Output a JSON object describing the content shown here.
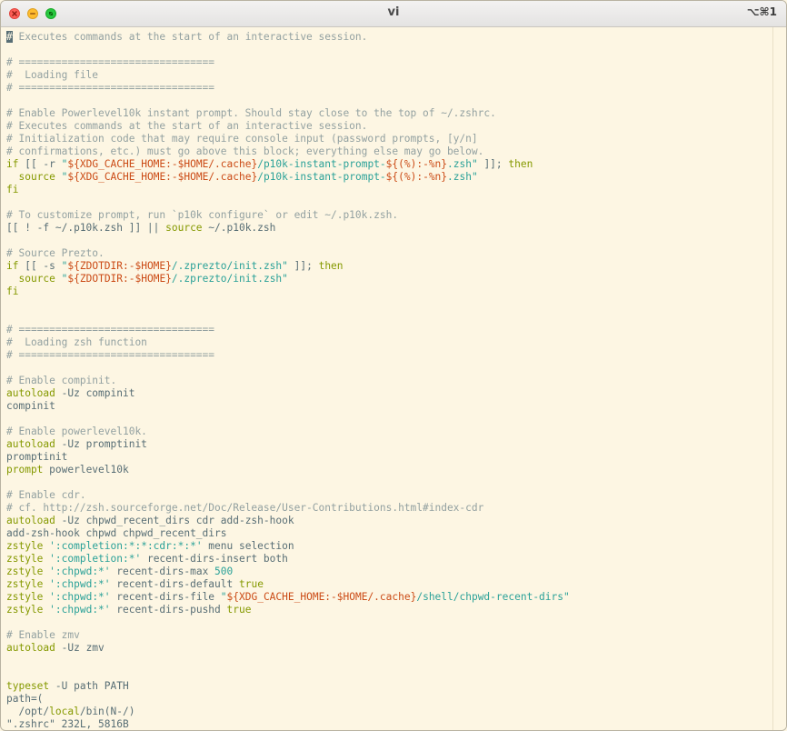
{
  "window": {
    "title": "vi",
    "shortcut": "⌥⌘1"
  },
  "colors": {
    "background": "#fdf6e3",
    "text": "#586e75",
    "comment": "#93a1a1",
    "keyword": "#859900",
    "string": "#2aa198",
    "variable": "#cb4b16",
    "number": "#2aa198"
  },
  "editor": {
    "lines": [
      [
        {
          "t": "#",
          "c": "cursor"
        },
        {
          "t": " Executes commands at the start of an interactive session.",
          "c": "comment"
        }
      ],
      [],
      [
        {
          "t": "# ================================",
          "c": "comment"
        }
      ],
      [
        {
          "t": "#  Loading file",
          "c": "comment"
        }
      ],
      [
        {
          "t": "# ================================",
          "c": "comment"
        }
      ],
      [],
      [
        {
          "t": "# Enable Powerlevel10k instant prompt. Should stay close to the top of ~/.zshrc.",
          "c": "comment"
        }
      ],
      [
        {
          "t": "# Executes commands at the start of an interactive session.",
          "c": "comment"
        }
      ],
      [
        {
          "t": "# Initialization code that may require console input (password prompts, [y/n]",
          "c": "comment"
        }
      ],
      [
        {
          "t": "# confirmations, etc.) must go above this block; everything else may go below.",
          "c": "comment"
        }
      ],
      [
        {
          "t": "if",
          "c": "keyword"
        },
        {
          "t": " [[ -r ",
          "c": "text"
        },
        {
          "t": "\"",
          "c": "string"
        },
        {
          "t": "${XDG_CACHE_HOME:-$HOME/.cache}",
          "c": "variable"
        },
        {
          "t": "/p10k-instant-prompt-",
          "c": "string"
        },
        {
          "t": "${(%):-%n}",
          "c": "variable"
        },
        {
          "t": ".zsh\"",
          "c": "string"
        },
        {
          "t": " ]]; ",
          "c": "text"
        },
        {
          "t": "then",
          "c": "keyword"
        }
      ],
      [
        {
          "t": "  ",
          "c": "text"
        },
        {
          "t": "source",
          "c": "keyword"
        },
        {
          "t": " ",
          "c": "text"
        },
        {
          "t": "\"",
          "c": "string"
        },
        {
          "t": "${XDG_CACHE_HOME:-$HOME/.cache}",
          "c": "variable"
        },
        {
          "t": "/p10k-instant-prompt-",
          "c": "string"
        },
        {
          "t": "${(%):-%n}",
          "c": "variable"
        },
        {
          "t": ".zsh\"",
          "c": "string"
        }
      ],
      [
        {
          "t": "fi",
          "c": "keyword"
        }
      ],
      [],
      [
        {
          "t": "# To customize prompt, run `p10k configure` or edit ~/.p10k.zsh.",
          "c": "comment"
        }
      ],
      [
        {
          "t": "[[ ! -f ~/.p10k.zsh ]] || ",
          "c": "text"
        },
        {
          "t": "source",
          "c": "keyword"
        },
        {
          "t": " ~/.p10k.zsh",
          "c": "text"
        }
      ],
      [],
      [
        {
          "t": "# Source Prezto.",
          "c": "comment"
        }
      ],
      [
        {
          "t": "if",
          "c": "keyword"
        },
        {
          "t": " [[ -s ",
          "c": "text"
        },
        {
          "t": "\"",
          "c": "string"
        },
        {
          "t": "${ZDOTDIR:-$HOME}",
          "c": "variable"
        },
        {
          "t": "/.zprezto/init.zsh\"",
          "c": "string"
        },
        {
          "t": " ]]; ",
          "c": "text"
        },
        {
          "t": "then",
          "c": "keyword"
        }
      ],
      [
        {
          "t": "  ",
          "c": "text"
        },
        {
          "t": "source",
          "c": "keyword"
        },
        {
          "t": " ",
          "c": "text"
        },
        {
          "t": "\"",
          "c": "string"
        },
        {
          "t": "${ZDOTDIR:-$HOME}",
          "c": "variable"
        },
        {
          "t": "/.zprezto/init.zsh\"",
          "c": "string"
        }
      ],
      [
        {
          "t": "fi",
          "c": "keyword"
        }
      ],
      [],
      [],
      [
        {
          "t": "# ================================",
          "c": "comment"
        }
      ],
      [
        {
          "t": "#  Loading zsh function",
          "c": "comment"
        }
      ],
      [
        {
          "t": "# ================================",
          "c": "comment"
        }
      ],
      [],
      [
        {
          "t": "# Enable compinit.",
          "c": "comment"
        }
      ],
      [
        {
          "t": "autoload",
          "c": "keyword"
        },
        {
          "t": " -Uz compinit",
          "c": "text"
        }
      ],
      [
        {
          "t": "compinit",
          "c": "text"
        }
      ],
      [],
      [
        {
          "t": "# Enable powerlevel10k.",
          "c": "comment"
        }
      ],
      [
        {
          "t": "autoload",
          "c": "keyword"
        },
        {
          "t": " -Uz promptinit",
          "c": "text"
        }
      ],
      [
        {
          "t": "promptinit",
          "c": "text"
        }
      ],
      [
        {
          "t": "prompt",
          "c": "keyword"
        },
        {
          "t": " powerlevel10k",
          "c": "text"
        }
      ],
      [],
      [
        {
          "t": "# Enable cdr.",
          "c": "comment"
        }
      ],
      [
        {
          "t": "# cf. http://zsh.sourceforge.net/Doc/Release/User-Contributions.html#index-cdr",
          "c": "comment"
        }
      ],
      [
        {
          "t": "autoload",
          "c": "keyword"
        },
        {
          "t": " -Uz chpwd_recent_dirs cdr add-zsh-hook",
          "c": "text"
        }
      ],
      [
        {
          "t": "add-zsh-hook chpwd chpwd_recent_dirs",
          "c": "text"
        }
      ],
      [
        {
          "t": "zstyle",
          "c": "keyword"
        },
        {
          "t": " ",
          "c": "text"
        },
        {
          "t": "':completion:*:*:cdr:*:*'",
          "c": "string"
        },
        {
          "t": " menu selection",
          "c": "text"
        }
      ],
      [
        {
          "t": "zstyle",
          "c": "keyword"
        },
        {
          "t": " ",
          "c": "text"
        },
        {
          "t": "':completion:*'",
          "c": "string"
        },
        {
          "t": " recent-dirs-insert both",
          "c": "text"
        }
      ],
      [
        {
          "t": "zstyle",
          "c": "keyword"
        },
        {
          "t": " ",
          "c": "text"
        },
        {
          "t": "':chpwd:*'",
          "c": "string"
        },
        {
          "t": " recent-dirs-max ",
          "c": "text"
        },
        {
          "t": "500",
          "c": "number"
        }
      ],
      [
        {
          "t": "zstyle",
          "c": "keyword"
        },
        {
          "t": " ",
          "c": "text"
        },
        {
          "t": "':chpwd:*'",
          "c": "string"
        },
        {
          "t": " recent-dirs-default ",
          "c": "text"
        },
        {
          "t": "true",
          "c": "keyword"
        }
      ],
      [
        {
          "t": "zstyle",
          "c": "keyword"
        },
        {
          "t": " ",
          "c": "text"
        },
        {
          "t": "':chpwd:*'",
          "c": "string"
        },
        {
          "t": " recent-dirs-file ",
          "c": "text"
        },
        {
          "t": "\"",
          "c": "string"
        },
        {
          "t": "${XDG_CACHE_HOME:-$HOME/.cache}",
          "c": "variable"
        },
        {
          "t": "/shell/chpwd-recent-dirs\"",
          "c": "string"
        }
      ],
      [
        {
          "t": "zstyle",
          "c": "keyword"
        },
        {
          "t": " ",
          "c": "text"
        },
        {
          "t": "':chpwd:*'",
          "c": "string"
        },
        {
          "t": " recent-dirs-pushd ",
          "c": "text"
        },
        {
          "t": "true",
          "c": "keyword"
        }
      ],
      [],
      [
        {
          "t": "# Enable zmv",
          "c": "comment"
        }
      ],
      [
        {
          "t": "autoload",
          "c": "keyword"
        },
        {
          "t": " -Uz zmv",
          "c": "text"
        }
      ],
      [],
      [],
      [
        {
          "t": "typeset",
          "c": "keyword"
        },
        {
          "t": " -U path PATH",
          "c": "text"
        }
      ],
      [
        {
          "t": "path=(",
          "c": "text"
        }
      ],
      [
        {
          "t": "  /opt/",
          "c": "text"
        },
        {
          "t": "local",
          "c": "keyword"
        },
        {
          "t": "/bin(N-/)",
          "c": "text"
        }
      ],
      [
        {
          "t": "\".zshrc\" 232L, 5816B",
          "c": "text"
        }
      ]
    ]
  }
}
